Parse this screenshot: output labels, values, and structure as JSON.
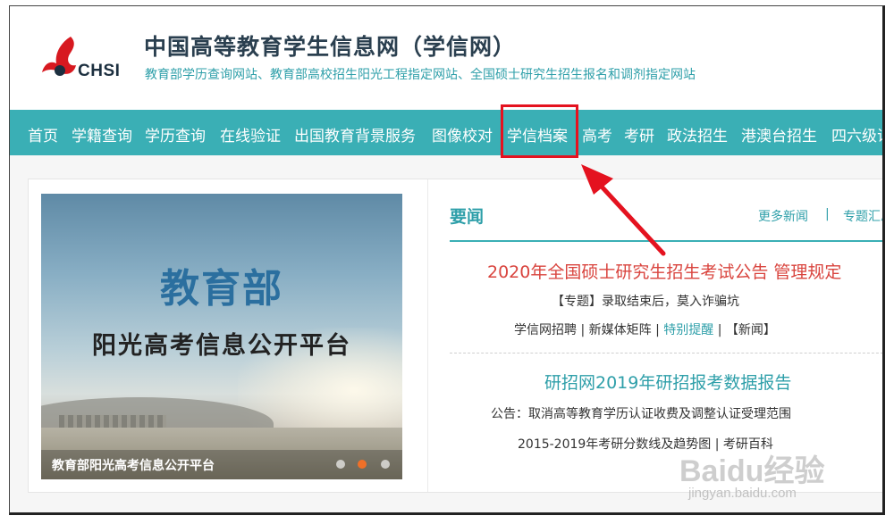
{
  "header": {
    "logo_text": "CHSI",
    "site_title": "中国高等教育学生信息网（学信网）",
    "site_subtitle": "教育部学历查询网站、教育部高校招生阳光工程指定网站、全国硕士研究生招生报名和调剂指定网站"
  },
  "nav": {
    "items": [
      {
        "label": "首页"
      },
      {
        "label": "学籍查询"
      },
      {
        "label": "学历查询"
      },
      {
        "label": "在线验证"
      },
      {
        "label": "出国教育背景服务"
      },
      {
        "label": "图像校对"
      },
      {
        "label": "学信档案",
        "highlighted": true
      },
      {
        "label": "高考"
      },
      {
        "label": "考研"
      },
      {
        "label": "政法招生"
      },
      {
        "label": "港澳台招生"
      },
      {
        "label": "四六级证"
      }
    ],
    "bg_color": "#3aafb5"
  },
  "banner": {
    "title_main": "教育部",
    "title_sub": "阳光高考信息公开平台",
    "caption": "教育部阳光高考信息公开平台",
    "slides_count": 3,
    "active_slide": 2
  },
  "news": {
    "heading": "要闻",
    "more_link": "更多新闻",
    "separator": "|",
    "topics_link": "专题汇总",
    "headline1": "2020年全国硕士研究生招生考试公告 管理规定",
    "line1": "【专题】录取结束后，莫入诈骗坑",
    "line2": {
      "a": "学信网招聘",
      "sep1": "|",
      "b": "新媒体矩阵",
      "sep2": "|",
      "c": "特别提醒",
      "sep3": "|",
      "d": "【新闻】"
    },
    "headline2": "研招网2019年研招报考数据报告",
    "line3": "公告：取消高等教育学历认证收费及调整认证受理范围",
    "line4": "2015-2019年考研分数线及趋势图 | 考研百科"
  },
  "watermark": {
    "logo": "Baidu经验",
    "url": "jingyan.baidu.com"
  },
  "colors": {
    "accent": "#3aafb5",
    "highlight_red": "#e4121f",
    "headline_red": "#d9443e",
    "link_teal": "#2e9fa9"
  }
}
